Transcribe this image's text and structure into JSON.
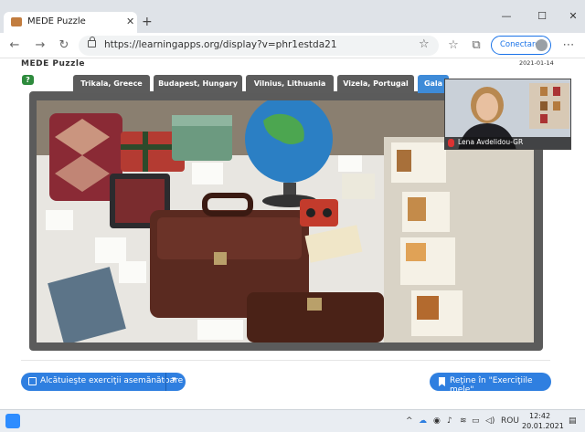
{
  "browser": {
    "tab_title": "MEDE Puzzle",
    "tab_close": "✕",
    "new_tab": "+",
    "url": "https://learningapps.org/display?v=phr1estda21",
    "signin_label": "Conectare",
    "minimize": "—",
    "maximize": "☐",
    "close": "✕"
  },
  "app": {
    "title": "MEDE Puzzle",
    "date": "2021-01-14",
    "help": "?"
  },
  "puzzle_tabs": [
    {
      "label": "Trikala, Greece"
    },
    {
      "label": "Budapest, Hungary"
    },
    {
      "label": "Vilnius, Lithuania"
    },
    {
      "label": "Vizela, Portugal"
    },
    {
      "label": "Gala"
    }
  ],
  "video": {
    "participant": "Lena Avdelidou-GR"
  },
  "buttons": {
    "similar": "Alcătuieşte exerciţii asemănătoare",
    "save": "Reţine în \"Exerciţiile mele\""
  },
  "taskbar": {
    "language": "ROU",
    "time": "12:42",
    "date": "20.01.2021"
  },
  "colors": {
    "accent": "#2f7fe0",
    "tab_dark": "#5c5c5c",
    "tab_active": "#3e8bd8"
  }
}
